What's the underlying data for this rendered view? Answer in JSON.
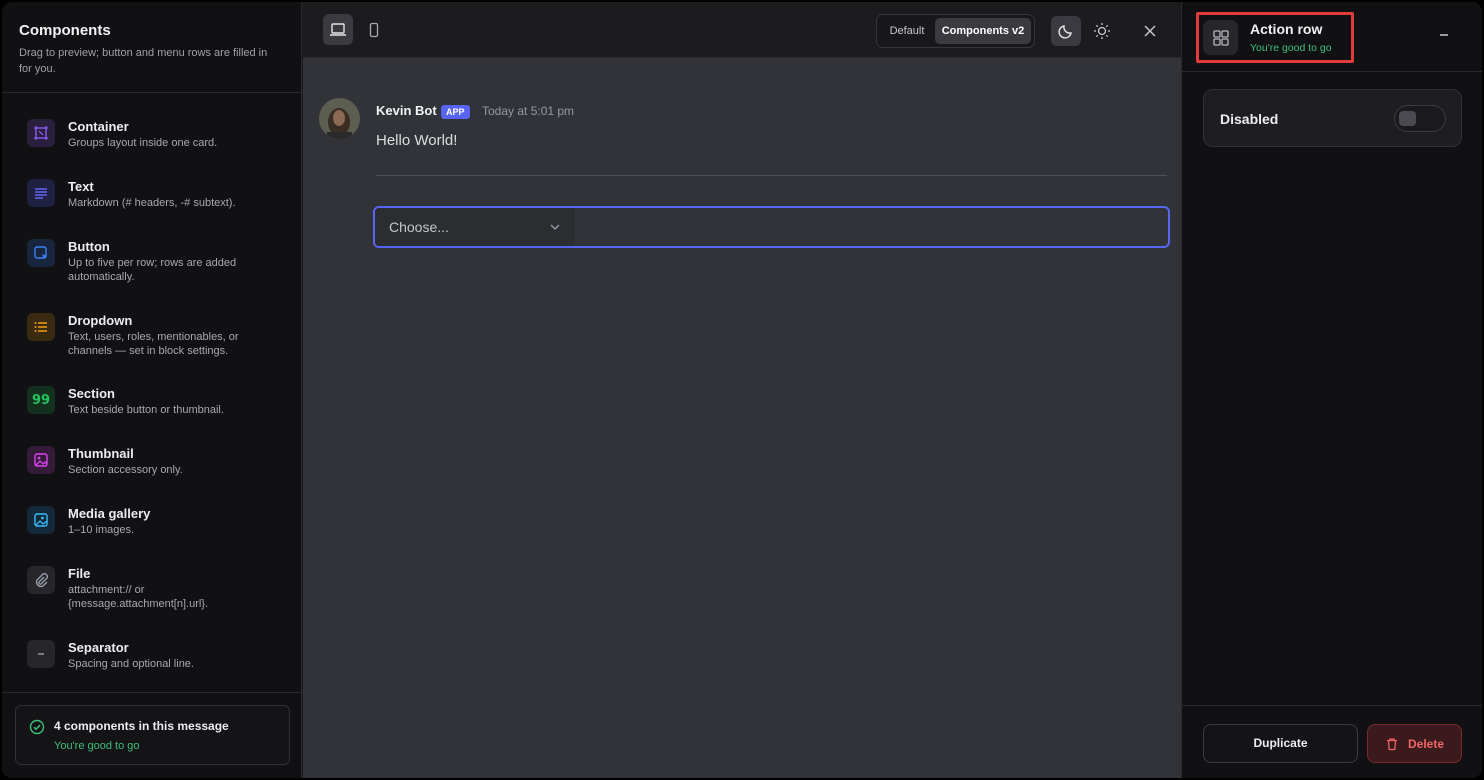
{
  "sidebar": {
    "title": "Components",
    "description": "Drag to preview; button and menu rows are filled in for you.",
    "items": [
      {
        "name": "Container",
        "desc": "Groups layout inside one card.",
        "icon": "container-icon",
        "color": "#8b5cf6"
      },
      {
        "name": "Text",
        "desc": "Markdown (# headers, -# subtext).",
        "icon": "text-lines-icon",
        "color": "#6366f1"
      },
      {
        "name": "Button",
        "desc": "Up to five per row; rows are added automatically.",
        "icon": "button-cursor-icon",
        "color": "#3b82f6"
      },
      {
        "name": "Dropdown",
        "desc": "Text, users, roles, mentionables, or channels — set in block settings.",
        "icon": "list-icon",
        "color": "#f59e0b"
      },
      {
        "name": "Section",
        "desc": "Text beside button or thumbnail.",
        "icon": "quote-icon",
        "color": "#22c55e"
      },
      {
        "name": "Thumbnail",
        "desc": "Section accessory only.",
        "icon": "image-icon",
        "color": "#d946ef"
      },
      {
        "name": "Media gallery",
        "desc": "1–10 images.",
        "icon": "gallery-icon",
        "color": "#38bdf8"
      },
      {
        "name": "File",
        "desc": "attachment:// or {message.attachment[n].url}.",
        "icon": "paperclip-icon",
        "color": "#9ca3af"
      },
      {
        "name": "Separator",
        "desc": "Spacing and optional line.",
        "icon": "minus-icon",
        "color": "#9ca3af"
      }
    ],
    "status": {
      "title": "4 components in this message",
      "subtitle": "You're good to go"
    }
  },
  "toolbar": {
    "mode_options": [
      "Default",
      "Components v2"
    ],
    "mode_selected": "Components v2"
  },
  "message": {
    "author": "Kevin Bot",
    "tag": "APP",
    "timestamp": "Today at 5:01 pm",
    "content": "Hello World!",
    "select_placeholder": "Choose..."
  },
  "panel": {
    "title": "Action row",
    "subtitle": "You're good to go",
    "option_label": "Disabled",
    "option_value": false,
    "duplicate_label": "Duplicate",
    "delete_label": "Delete"
  },
  "colors": {
    "accent": "#5865f2",
    "success": "#3fbf7a",
    "danger": "#f06565",
    "highlight": "#e23b3b"
  }
}
